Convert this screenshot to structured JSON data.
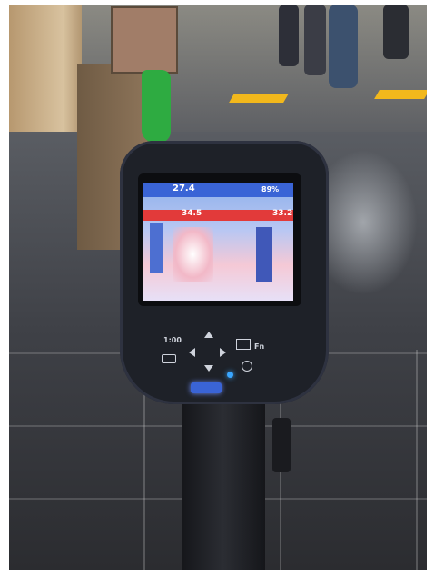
{
  "photo": {
    "subject": "thermal-imaging-camera-in-corridor",
    "colors": {
      "wall": "#c9b08a",
      "floor": "#45474d",
      "floor_marker": "#f2b81c",
      "camera_body": "#1e2128",
      "screen_sky": "#8fb0ea",
      "screen_bar": "#e23a3a"
    }
  },
  "camera_screen": {
    "top_reading": "27.4",
    "battery": "89%",
    "alarm_reading": "34.5",
    "right_reading": "33.2"
  },
  "keypad": {
    "left_key": "1:00",
    "right_key": "Fn"
  }
}
